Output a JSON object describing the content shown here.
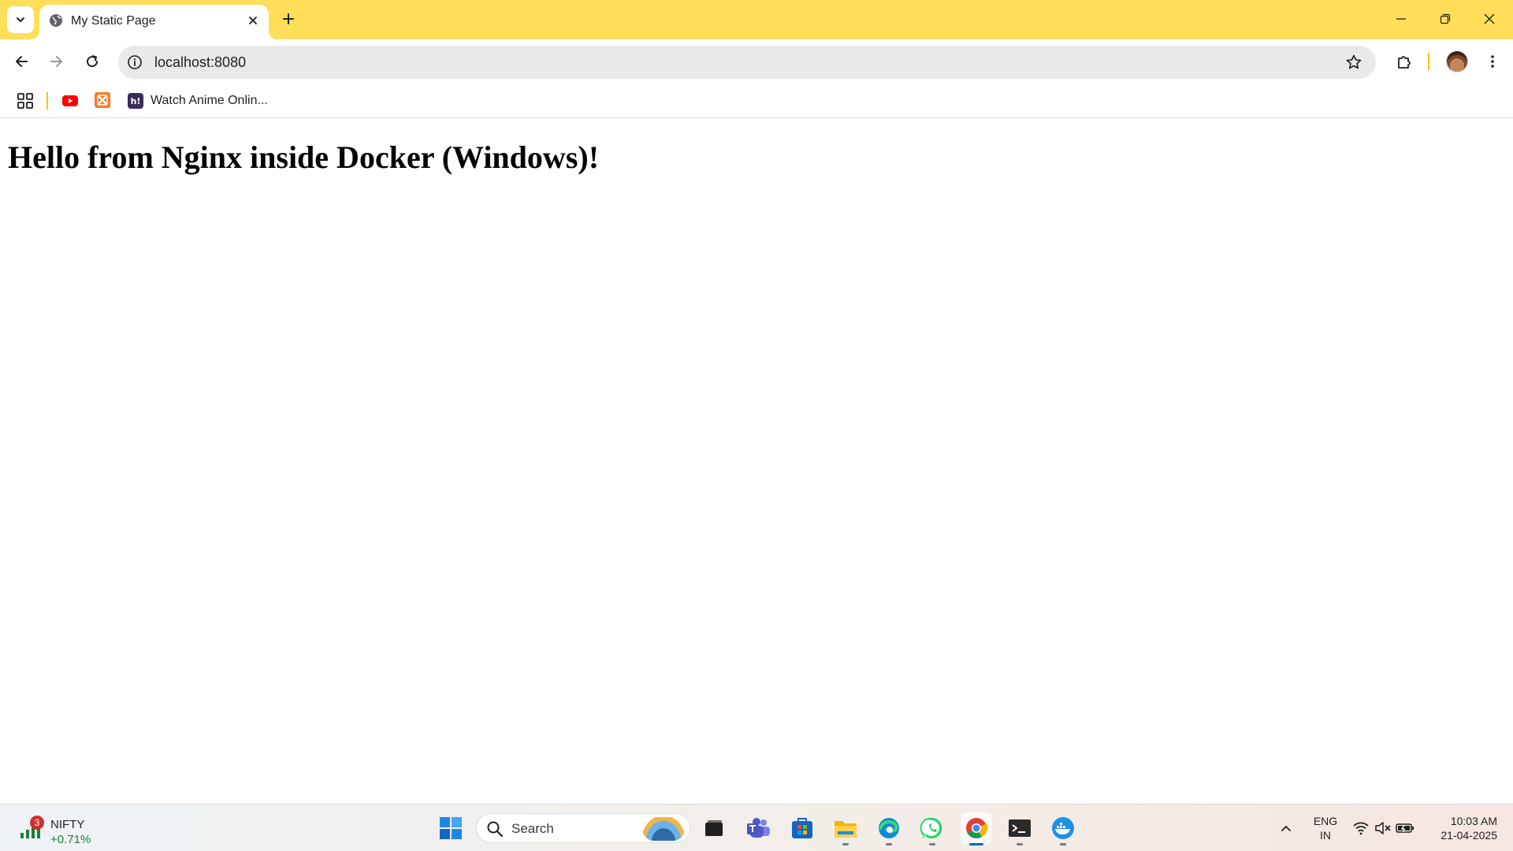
{
  "browser": {
    "tab": {
      "title": "My Static Page",
      "favicon": "globe-icon"
    },
    "omnibox": {
      "url": "localhost:8080"
    },
    "bookmarks": [
      {
        "icon": "apps-grid-icon"
      },
      {
        "icon": "youtube-icon"
      },
      {
        "icon": "xampp-icon"
      },
      {
        "icon": "hianime-icon",
        "icon_text": "h!",
        "label": "Watch Anime Onlin..."
      }
    ],
    "colors": {
      "tabstrip": "#ffde59",
      "separator": "#f1c40f"
    }
  },
  "page": {
    "heading": "Hello from Nginx inside Docker (Windows)!"
  },
  "taskbar": {
    "widget": {
      "badge": "3",
      "name": "NIFTY",
      "change": "+0.71%",
      "change_color": "#1a7f37"
    },
    "search": {
      "label": "Search"
    },
    "pinned": [
      "windows-start-icon",
      "task-view-icon",
      "teams-icon",
      "microsoft-store-icon",
      "file-explorer-icon",
      "edge-icon",
      "whatsapp-icon",
      "chrome-icon",
      "terminal-icon",
      "docker-icon"
    ],
    "tray": {
      "language_line1": "ENG",
      "language_line2": "IN",
      "time": "10:03 AM",
      "date": "21-04-2025"
    }
  }
}
